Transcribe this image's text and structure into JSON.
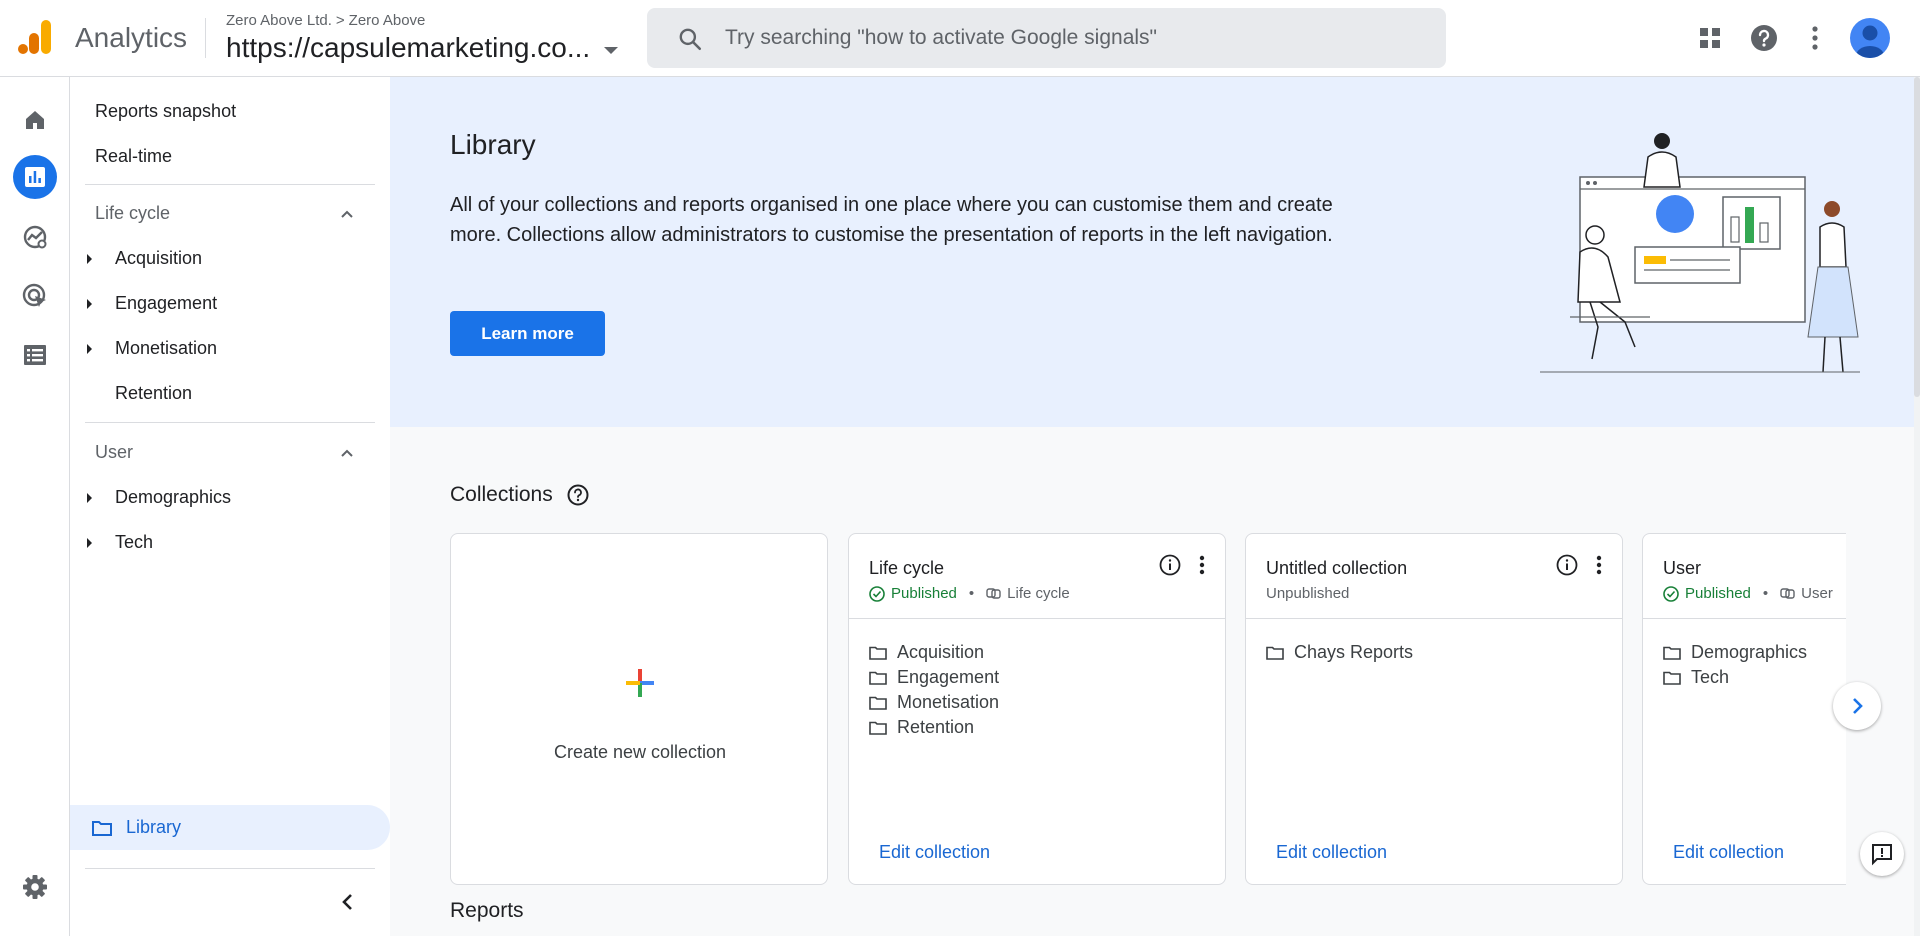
{
  "header": {
    "app_name": "Analytics",
    "breadcrumb_account": "Zero Above Ltd.",
    "breadcrumb_sep": ">",
    "breadcrumb_property": "Zero Above",
    "property_name": "https://capsulemarketing.co...",
    "search_placeholder": "Try searching \"how to activate Google signals\"",
    "icons": [
      "apps-grid-icon",
      "help-icon",
      "more-vert-icon",
      "account-avatar"
    ]
  },
  "rail": {
    "items": [
      "home-icon",
      "reports-icon",
      "explore-icon",
      "advertising-icon",
      "configure-icon"
    ],
    "settings": "settings-gear-icon"
  },
  "sidebar": {
    "reports_snapshot": "Reports snapshot",
    "realtime": "Real-time",
    "lifecycle_section": "Life cycle",
    "lifecycle_items": [
      "Acquisition",
      "Engagement",
      "Monetisation",
      "Retention"
    ],
    "user_section": "User",
    "user_items": [
      "Demographics",
      "Tech"
    ],
    "library": "Library"
  },
  "hero": {
    "title": "Library",
    "description": "All of your collections and reports organised in one place where you can customise them and create more. Collections allow administrators to customise the presentation of reports in the left navigation.",
    "button": "Learn more"
  },
  "collections": {
    "heading": "Collections",
    "create_label": "Create new collection",
    "cards": [
      {
        "title": "Life cycle",
        "status": "Published",
        "category": "Life cycle",
        "items": [
          "Acquisition",
          "Engagement",
          "Monetisation",
          "Retention"
        ],
        "edit": "Edit collection"
      },
      {
        "title": "Untitled collection",
        "status": "Unpublished",
        "category": "",
        "items": [
          "Chays Reports"
        ],
        "edit": "Edit collection"
      },
      {
        "title": "User",
        "status": "Published",
        "category": "User",
        "items": [
          "Demographics",
          "Tech"
        ],
        "edit": "Edit collection"
      }
    ]
  },
  "reports": {
    "heading": "Reports"
  },
  "colors": {
    "accent": "#1a73e8",
    "published": "#188038",
    "hero_bg": "#e8f0fe"
  }
}
